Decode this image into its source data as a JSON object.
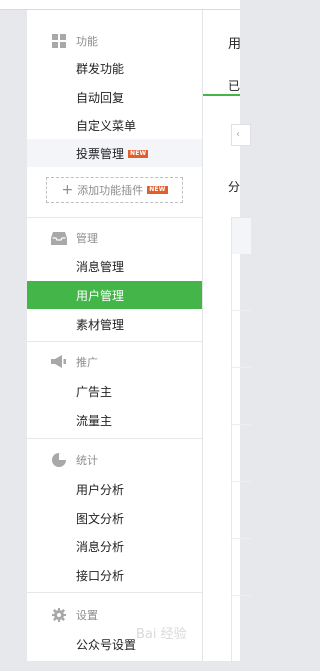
{
  "sidebar": {
    "groups": [
      {
        "header": "功能",
        "icon": "grid-icon",
        "items": [
          "群发功能",
          "自动回复",
          "自定义菜单",
          "投票管理"
        ],
        "new_badge": "NEW",
        "add_plugin": "添加功能插件"
      },
      {
        "header": "管理",
        "icon": "inbox-icon",
        "items": [
          "消息管理",
          "用户管理",
          "素材管理"
        ]
      },
      {
        "header": "推广",
        "icon": "megaphone-icon",
        "items": [
          "广告主",
          "流量主"
        ]
      },
      {
        "header": "统计",
        "icon": "pie-chart-icon",
        "items": [
          "用户分析",
          "图文分析",
          "消息分析",
          "接口分析"
        ]
      },
      {
        "header": "设置",
        "icon": "gear-icon",
        "items": [
          "公众号设置"
        ]
      }
    ],
    "active_item": "用户管理",
    "accent_color": "#44b549",
    "badge_color": "#e15f2a"
  },
  "main": {
    "title": "用",
    "tab": "已",
    "search_text": "‹",
    "group_label": "分"
  },
  "watermark": "Bai 经验"
}
